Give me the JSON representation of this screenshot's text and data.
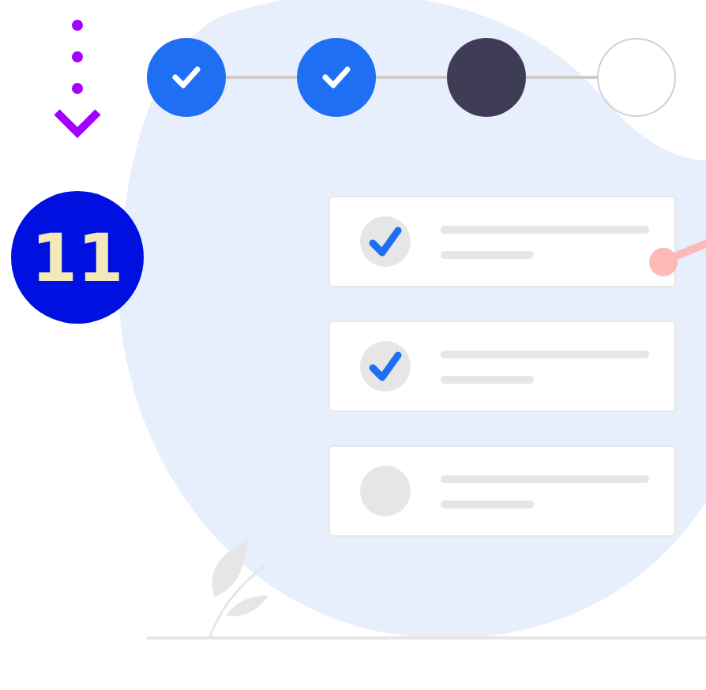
{
  "badge": {
    "label": "11"
  },
  "steps": [
    {
      "kind": "done"
    },
    {
      "kind": "done"
    },
    {
      "kind": "current"
    },
    {
      "kind": "pending"
    }
  ],
  "tasks": [
    {
      "checked": true
    },
    {
      "checked": true
    },
    {
      "checked": false
    }
  ]
}
